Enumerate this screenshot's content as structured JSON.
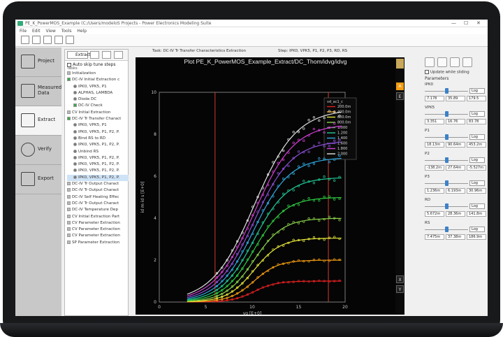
{
  "window": {
    "title": "PE_K_PowerMOS_Example (C:/Users/modeloS Projects    -  Power Electronics Modeling Suite",
    "controls": {
      "minimize": "—",
      "maximize": "☐",
      "close": "✕"
    }
  },
  "menu": [
    "File",
    "Edit",
    "View",
    "Tools",
    "Help"
  ],
  "nav": [
    {
      "label": "Project",
      "icon": "folder-icon"
    },
    {
      "label": "Measured Data",
      "icon": "grid-icon"
    },
    {
      "label": "Extract",
      "icon": "extract-icon",
      "active": true
    },
    {
      "label": "Verify",
      "icon": "check-icon"
    },
    {
      "label": "Export",
      "icon": "table-icon"
    }
  ],
  "tasks_panel": {
    "extract_label": "Extract",
    "autoskip_label": "Auto skip tune steps",
    "tasks_header": "Tasks",
    "items": [
      {
        "text": "Initialization",
        "indent": 0,
        "kind": "grey"
      },
      {
        "text": "DC-IV Initial Extraction c",
        "indent": 0,
        "kind": "green"
      },
      {
        "text": "IPK0, VPK5, P1",
        "indent": 1,
        "kind": "gear"
      },
      {
        "text": "ALPHAS, LAMBDA",
        "indent": 1,
        "kind": "gear"
      },
      {
        "text": "Diode DC",
        "indent": 1,
        "kind": "gear"
      },
      {
        "text": "DC-IV Check",
        "indent": 1,
        "kind": "check"
      },
      {
        "text": "CV Initial Extraction",
        "indent": 0,
        "kind": "grey"
      },
      {
        "text": "DC-IV Tr Transfer Charact",
        "indent": 0,
        "kind": "green"
      },
      {
        "text": "IPK0, VPK5, P1",
        "indent": 1,
        "kind": "gear"
      },
      {
        "text": "IPK0, VPK5, P1, P2, P.",
        "indent": 1,
        "kind": "gear"
      },
      {
        "text": "Bind RS to RD",
        "indent": 1,
        "kind": "gear"
      },
      {
        "text": "IPK0, VPK5, P1, P2, P.",
        "indent": 1,
        "kind": "gear"
      },
      {
        "text": "Unbind RS",
        "indent": 1,
        "kind": "gear"
      },
      {
        "text": "IPK0, VPK5, P1, P2, P.",
        "indent": 1,
        "kind": "gear"
      },
      {
        "text": "IPK0, VPK5, P1, P2, P.",
        "indent": 1,
        "kind": "gear"
      },
      {
        "text": "IPK0, VPK5, P1, P2, P.",
        "indent": 1,
        "kind": "gear"
      },
      {
        "text": "IPK0, VPK5, P1, P2, P.",
        "indent": 1,
        "kind": "gear",
        "active": true
      },
      {
        "text": "DC-IV Tr Output Charact",
        "indent": 0,
        "kind": "grey"
      },
      {
        "text": "DC-IV Tr Output Charact",
        "indent": 0,
        "kind": "grey"
      },
      {
        "text": "DC-IV Self Heating Effec",
        "indent": 0,
        "kind": "grey"
      },
      {
        "text": "DC-IV Tr Output Charact",
        "indent": 0,
        "kind": "grey"
      },
      {
        "text": "DC-IV Temperature Dep",
        "indent": 0,
        "kind": "grey"
      },
      {
        "text": "CV Initial Extraction Part",
        "indent": 0,
        "kind": "grey"
      },
      {
        "text": "CV Parameter Extraction",
        "indent": 0,
        "kind": "grey"
      },
      {
        "text": "CV Parameter Extraction",
        "indent": 0,
        "kind": "grey"
      },
      {
        "text": "CV Parameter Extraction",
        "indent": 0,
        "kind": "grey"
      },
      {
        "text": "SP Parameter Extraction",
        "indent": 0,
        "kind": "grey"
      }
    ]
  },
  "task_header": {
    "task_label": "Task:",
    "task_value": "DC-IV Tr Transfer Characteristics Extraction",
    "step_label": "Step:",
    "step_value": "IPK0, VPK5, P1, P2, P3, RD, RS"
  },
  "plot_side": {
    "a_label": "A",
    "e_label": "E",
    "x_label": "X",
    "y_label": "Y"
  },
  "params_panel": {
    "update_label": "Update while sliding",
    "header": "Parameters",
    "params": [
      {
        "name": "IPK0",
        "scale": "Log",
        "min": "7.178",
        "value": "35.89",
        "max": "179.5",
        "fraction": 0.5
      },
      {
        "name": "VPK5",
        "scale": "Log",
        "min": "3.351",
        "value": "16.76",
        "max": "83.78",
        "fraction": 0.5
      },
      {
        "name": "P1",
        "scale": "Log",
        "min": "18.13m",
        "value": "90.64m",
        "max": "453.2m",
        "fraction": 0.5
      },
      {
        "name": "P2",
        "scale": "Log",
        "min": "-138.2m",
        "value": "27.64m",
        "max": "-5.527m",
        "fraction": 0.5
      },
      {
        "name": "P3",
        "scale": "Log",
        "min": "1.236m",
        "value": "6.193m",
        "max": "30.96m",
        "fraction": 0.5
      },
      {
        "name": "RD",
        "scale": "Log",
        "min": "5.672m",
        "value": "28.36m",
        "max": "141.8m",
        "fraction": 0.5
      },
      {
        "name": "RS",
        "scale": "Log",
        "min": "7.475m",
        "value": "37.38m",
        "max": "186.9m",
        "fraction": 0.5
      }
    ]
  },
  "chart_data": {
    "type": "line",
    "title": "Plot PE_K_PowerMOS_Example_Extract/DC_Thom/idvg/idvg",
    "xlabel": "vg   [E+0]",
    "ylabel": "id m  id s\n[E+0]",
    "xlim": [
      0,
      20
    ],
    "ylim": [
      0,
      10
    ],
    "xticks": [
      "0",
      "5",
      "10",
      "15",
      "20"
    ],
    "yticks": [
      "0",
      "2",
      "4",
      "6",
      "8",
      "10"
    ],
    "vlines": [
      6.0,
      18.2
    ],
    "legend": {
      "title": "vd_ac1_c",
      "entries": [
        "200.0m",
        "400.0m",
        "600.0m",
        "800.0m",
        "1.000",
        "1.200",
        "1.400",
        "1.600",
        "1.800",
        "2.000"
      ],
      "colors": [
        "#e02020",
        "#f39c12",
        "#e6e63a",
        "#8ad14a",
        "#2ecc40",
        "#20c997",
        "#2fa8e0",
        "#8a4fd6",
        "#d23fd6",
        "#e0e0e0"
      ],
      "plateaus": [
        1.0,
        2.0,
        3.05,
        4.0,
        5.0,
        5.95,
        6.9,
        7.7,
        8.5,
        9.2
      ]
    },
    "grid": false
  }
}
